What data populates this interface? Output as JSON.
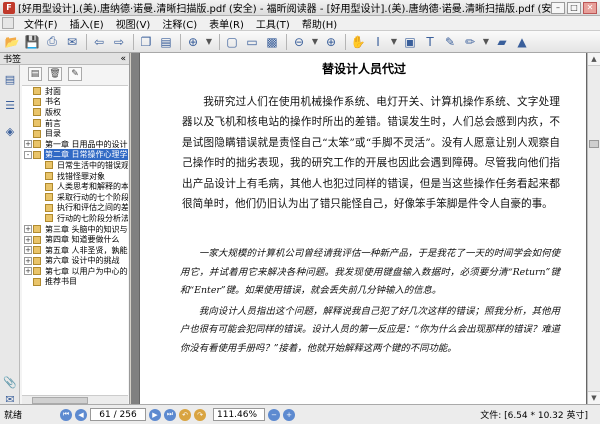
{
  "window": {
    "title": "[好用型设计].(美).唐纳德·诺曼.清晰扫描版.pdf (安全) - 福昕阅读器 - [好用型设计].(美).唐纳德·诺曼.清晰扫描版.pdf (安全)",
    "app_icon": "foxit-logo-icon"
  },
  "menu": [
    "文件(F)",
    "插入(E)",
    "视图(V)",
    "注释(C)",
    "表单(R)",
    "工具(T)",
    "帮助(H)"
  ],
  "sidebar": {
    "header": "书签",
    "tree": [
      {
        "label": "封面",
        "level": 0,
        "exp": ""
      },
      {
        "label": "书名",
        "level": 0,
        "exp": ""
      },
      {
        "label": "版权",
        "level": 0,
        "exp": ""
      },
      {
        "label": "前言",
        "level": 0,
        "exp": ""
      },
      {
        "label": "目录",
        "level": 0,
        "exp": ""
      },
      {
        "label": "第一章 日用品中的设计",
        "level": 0,
        "exp": "+"
      },
      {
        "label": "第二章 日常操作心理学",
        "level": 0,
        "exp": "-",
        "selected": true
      },
      {
        "label": "日常生活中的错误观念",
        "level": 1,
        "exp": ""
      },
      {
        "label": "找错怪罪对象",
        "level": 1,
        "exp": ""
      },
      {
        "label": "人类思考和解释的本质",
        "level": 1,
        "exp": ""
      },
      {
        "label": "采取行动的七个阶段",
        "level": 1,
        "exp": ""
      },
      {
        "label": "执行和评估之间的差距",
        "level": 1,
        "exp": ""
      },
      {
        "label": "行动的七阶段分析法",
        "level": 1,
        "exp": ""
      },
      {
        "label": "第三章 头脑中的知识与外界",
        "level": 0,
        "exp": "+"
      },
      {
        "label": "第四章 知道要做什么",
        "level": 0,
        "exp": "+"
      },
      {
        "label": "第五章 人非圣贤，孰能无过",
        "level": 0,
        "exp": "+"
      },
      {
        "label": "第六章 设计中的挑战",
        "level": 0,
        "exp": "+"
      },
      {
        "label": "第七章 以用户为中心的设计",
        "level": 0,
        "exp": "+"
      },
      {
        "label": "推荐书目",
        "level": 0,
        "exp": ""
      }
    ]
  },
  "document": {
    "heading": "替设计人员代过",
    "paragraph1": "我研究过人们在使用机械操作系统、电灯开关、计算机操作系统、文字处理器以及飞机和核电站的操作时所出的差错。错误发生时，人们总会感到内疚，不是试图隐瞒错误就是责怪自己“太笨”或“手脚不灵活”。没有人愿意让别人观察自己操作时的拙劣表现，我的研究工作的开展也因此会遇到障碍。尽管我向他们指出产品设计上有毛病，其他人也犯过同样的错误，但是当这些操作任务看起来都很简单时，他们仍旧认为出了错只能怪自己，好像笨手笨脚是件令人自豪的事。",
    "paragraph2": "一家大规模的计算机公司曾经请我评估一种新产品，于是我花了一天的时间学会如何使用它，并试着用它来解决各种问题。我发现使用键盘输入数据时，必须要分清“Return”键和“Enter”键。如果使用错误，就会丢失前几分钟输入的信息。",
    "paragraph3": "我向设计人员指出这个问题，解释说我自己犯了好几次这样的错误；照我分析，其他用户也很有可能会犯同样的错误。设计人员的第一反应是：“你为什么会出现那样的错误？难道你没有看使用手册吗？”接着，他就开始解释这两个键的不同功能。"
  },
  "status": {
    "ready": "就绪",
    "page": "61 / 256",
    "current_page": 61,
    "total_pages": 256,
    "zoom": "111.46%",
    "size": "文件: [6.54 * 10.32 英寸]"
  }
}
